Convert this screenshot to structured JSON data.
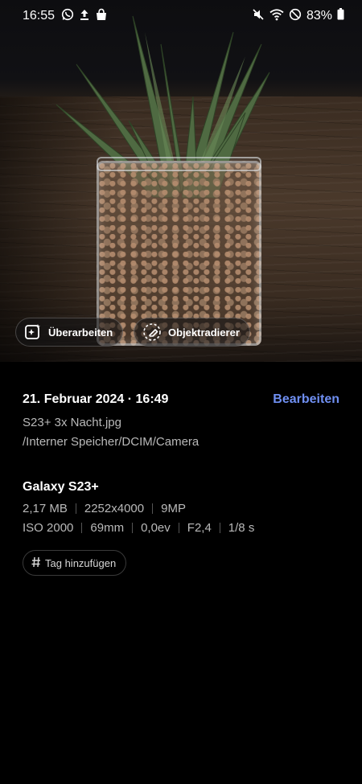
{
  "status_bar": {
    "time": "16:55",
    "battery": "83%",
    "icons_left": [
      "whatsapp-icon",
      "upload-icon",
      "shopping-bag-icon"
    ],
    "icons_right": [
      "mute-icon",
      "wifi-icon",
      "do-not-disturb-icon",
      "battery-icon"
    ]
  },
  "photo_actions": {
    "remaster_label": "Überarbeiten",
    "eraser_label": "Objektradierer"
  },
  "details": {
    "date": "21. Februar 2024 · 16:49",
    "edit_label": "Bearbeiten",
    "filename": "S23+ 3x Nacht.jpg",
    "path": "/Interner Speicher/DCIM/Camera",
    "device": "Galaxy S23+",
    "size": "2,17 MB",
    "resolution": "2252x4000",
    "megapixels": "9MP",
    "iso": "ISO 2000",
    "focal_length": "69mm",
    "exposure_value": "0,0ev",
    "aperture": "F2,4",
    "shutter": "1/8 s",
    "tag_label": "Tag hinzufügen"
  },
  "colors": {
    "accent": "#6f8ff2",
    "secondary_text": "#b9b9b9",
    "background": "#000000"
  }
}
